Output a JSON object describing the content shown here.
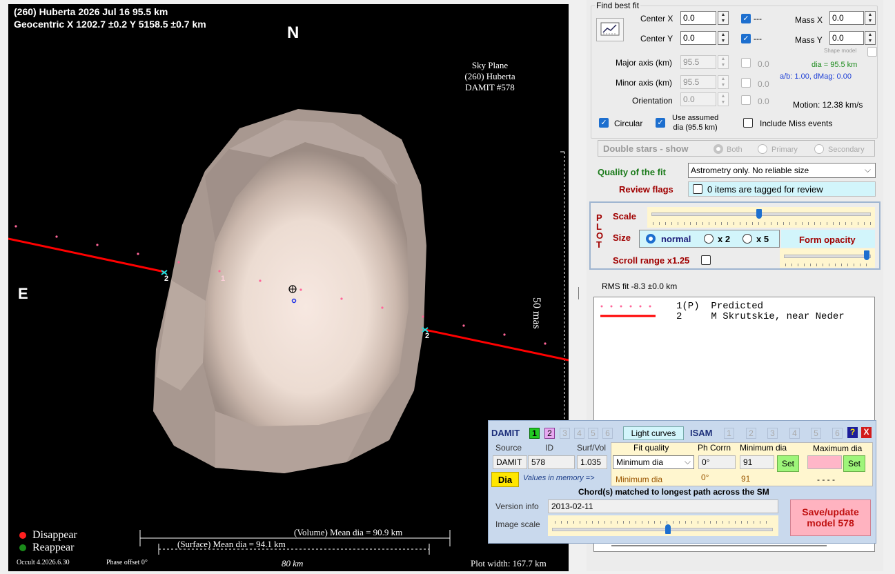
{
  "plot": {
    "header_line1": "(260) Huberta  2026 Jul 16   95.5 km",
    "header_line2": "Geocentric  X  1202.7 ±0.2  Y 5158.5 ±0.7 km",
    "north": "N",
    "east": "E",
    "sky_plane": [
      "Sky Plane",
      "(260) Huberta",
      "DAMIT #578"
    ],
    "scale_mas": "50 mas",
    "chord_labels": [
      "2",
      "1",
      "2"
    ],
    "legend_disappear": "Disappear",
    "legend_reappear": "Reappear",
    "volume_dia": "(Volume) Mean dia = 90.9 km",
    "surface_dia": "(Surface) Mean dia = 94.1 km",
    "scale_km": "80 km",
    "version": "Occult 4.2026.6.30",
    "phase_offset": "Phase offset 0°",
    "plot_width": "Plot width: 167.7 km",
    "colors": {
      "chord": "#ff0000",
      "predicted": "#ff6699",
      "disappear": "#ff2020",
      "reappear": "#1a8a1a",
      "shape": "#d9c6bd"
    }
  },
  "fit": {
    "title": "Find best fit",
    "center_x_label": "Center X",
    "center_x": "0.0",
    "center_y_label": "Center Y",
    "center_y": "0.0",
    "cx_check": "---",
    "cy_check": "---",
    "mass_x_label": "Mass X",
    "mass_x": "0.0",
    "mass_y_label": "Mass Y",
    "mass_y": "0.0",
    "shape_model": "Shape model",
    "major_label": "Major axis (km)",
    "major": "95.5",
    "major_chk": "0.0",
    "minor_label": "Minor axis (km)",
    "minor": "95.5",
    "minor_chk": "0.0",
    "orient_label": "Orientation",
    "orient": "0.0",
    "orient_chk": "0.0",
    "dia_text": "dia = 95.5 km",
    "ab_text": "a/b: 1.00, dMag: 0.00",
    "motion": "Motion: 12.38 km/s",
    "circular": "Circular",
    "use_assumed": "Use assumed",
    "use_assumed2": "dia (95.5 km)",
    "include_miss": "Include Miss events"
  },
  "double": {
    "label": "Double stars - show",
    "both": "Both",
    "primary": "Primary",
    "secondary": "Secondary"
  },
  "quality": {
    "label": "Quality of the fit",
    "value": "Astrometry only. No reliable size",
    "review_label": "Review flags",
    "review_text": "0 items are tagged for review"
  },
  "plotctl": {
    "letters": "PLOT",
    "scale": "Scale",
    "size": "Size",
    "normal": "normal",
    "x2": "x 2",
    "x5": "x 5",
    "form_opacity": "Form opacity",
    "scroll": "Scroll range x1.25"
  },
  "rms": "RMS fit -8.3 ±0.0 km",
  "observers": [
    {
      "num": "1(P)",
      "name": "Predicted"
    },
    {
      "num": "2",
      "name": "M Skrutskie, near Neder"
    }
  ],
  "damit": {
    "title": "DAMIT",
    "nums": [
      "1",
      "2",
      "3",
      "4",
      "5",
      "6"
    ],
    "light_curves": "Light curves",
    "isam": "ISAM",
    "isam_nums": [
      "1",
      "2",
      "3",
      "4",
      "5",
      "6"
    ],
    "help": "?",
    "close": "X",
    "h_source": "Source",
    "h_id": "ID",
    "h_surf": "Surf/Vol",
    "h_fit": "Fit quality",
    "h_ph": "Ph Corrn",
    "h_min": "Minimum dia",
    "h_max": "Maximum dia",
    "source": "DAMIT",
    "id": "578",
    "surf": "1.035",
    "fit_select": "Minimum dia",
    "ph": "0°",
    "min": "91",
    "set": "Set",
    "set2": "Set",
    "dia_btn": "Dia",
    "mem_label": "Values in memory =>",
    "mem_fit": "Minimum dia",
    "mem_ph": "0°",
    "mem_min": "91",
    "mem_max": "- - - -",
    "chord_msg": "Chord(s) matched to longest path across the SM",
    "version_label": "Version info",
    "version": "2013-02-11",
    "image_scale": "Image scale",
    "save": "Save/update",
    "save2": "model 578"
  }
}
